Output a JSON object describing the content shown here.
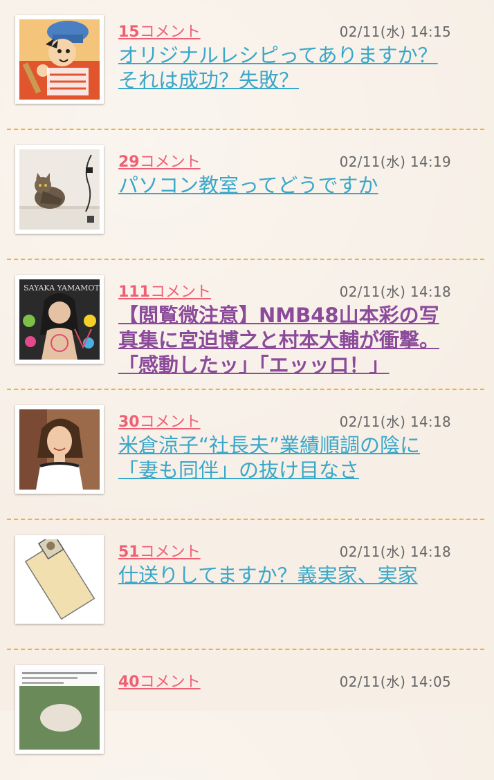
{
  "comment_label": "コメント",
  "items": [
    {
      "count": "15",
      "timestamp": "02/11(水) 14:15",
      "title": "オリジナルレシピってありますか？それは成功？失敗？",
      "visited": false,
      "thumb_icon": "cartoon-chef-icon"
    },
    {
      "count": "29",
      "timestamp": "02/11(水) 14:19",
      "title": "パソコン教室ってどうですか",
      "visited": false,
      "thumb_icon": "cat-photo-icon"
    },
    {
      "count": "111",
      "timestamp": "02/11(水) 14:18",
      "title": "【閲覧微注意】NMB48山本彩の写真集に宮迫博之と村本大輔が衝撃。「感動したッ」「エッッロ！」",
      "visited": true,
      "thumb_icon": "photobook-cover-icon",
      "thumb_text": "SAYAKA YAMAMOTO"
    },
    {
      "count": "30",
      "timestamp": "02/11(水) 14:18",
      "title": "米倉涼子“社長夫”業績順調の陰に「妻も同伴」の抜け目なさ",
      "visited": false,
      "thumb_icon": "woman-portrait-icon"
    },
    {
      "count": "51",
      "timestamp": "02/11(水) 14:18",
      "title": "仕送りしてますか？義実家、実家",
      "visited": false,
      "thumb_icon": "envelope-money-icon"
    },
    {
      "count": "40",
      "timestamp": "02/11(水) 14:05",
      "title": "",
      "visited": false,
      "thumb_icon": "news-clipping-icon"
    }
  ],
  "colors": {
    "count": "#ef5f73",
    "title": "#3aa7c9",
    "visited_title": "#8b4a9a",
    "divider": "#f0b040",
    "background": "#f7efe6"
  }
}
